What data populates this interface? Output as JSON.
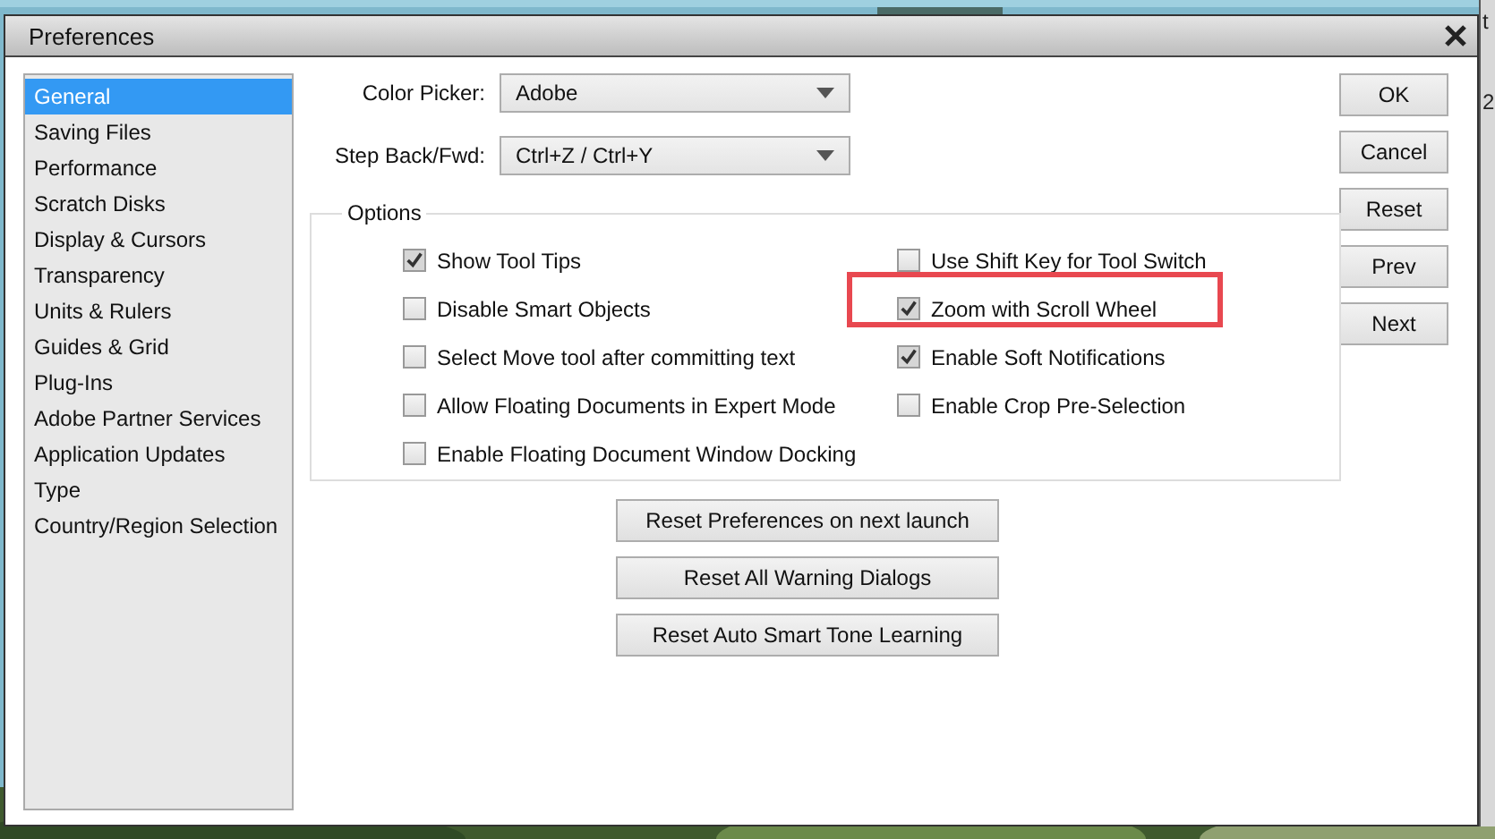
{
  "window": {
    "title": "Preferences"
  },
  "background_window": {
    "texts": [
      "t",
      "2"
    ]
  },
  "sidebar": {
    "items": [
      {
        "label": "General",
        "selected": true
      },
      {
        "label": "Saving Files",
        "selected": false
      },
      {
        "label": "Performance",
        "selected": false
      },
      {
        "label": "Scratch Disks",
        "selected": false
      },
      {
        "label": "Display & Cursors",
        "selected": false
      },
      {
        "label": "Transparency",
        "selected": false
      },
      {
        "label": "Units & Rulers",
        "selected": false
      },
      {
        "label": "Guides & Grid",
        "selected": false
      },
      {
        "label": "Plug-Ins",
        "selected": false
      },
      {
        "label": "Adobe Partner Services",
        "selected": false
      },
      {
        "label": "Application Updates",
        "selected": false
      },
      {
        "label": "Type",
        "selected": false
      },
      {
        "label": "Country/Region Selection",
        "selected": false
      }
    ]
  },
  "fields": [
    {
      "label": "Color Picker:",
      "value": "Adobe"
    },
    {
      "label": "Step Back/Fwd:",
      "value": "Ctrl+Z / Ctrl+Y"
    }
  ],
  "options": {
    "title": "Options",
    "columns": [
      [
        {
          "label": "Show Tool Tips",
          "checked": true,
          "highlighted": false
        },
        {
          "label": "Disable Smart Objects",
          "checked": false,
          "highlighted": false
        },
        {
          "label": "Select Move tool after committing text",
          "checked": false,
          "highlighted": false
        },
        {
          "label": "Allow Floating Documents in Expert Mode",
          "checked": false,
          "highlighted": false
        },
        {
          "label": "Enable Floating Document Window Docking",
          "checked": false,
          "highlighted": false
        }
      ],
      [
        {
          "label": "Use Shift Key for Tool Switch",
          "checked": false,
          "highlighted": false
        },
        {
          "label": "Zoom with Scroll Wheel",
          "checked": true,
          "highlighted": true
        },
        {
          "label": "Enable Soft Notifications",
          "checked": true,
          "highlighted": false
        },
        {
          "label": "Enable Crop Pre-Selection",
          "checked": false,
          "highlighted": false
        }
      ]
    ]
  },
  "reset_buttons": [
    "Reset Preferences on next launch",
    "Reset All Warning Dialogs",
    "Reset Auto Smart Tone Learning"
  ],
  "buttons": [
    "OK",
    "Cancel",
    "Reset",
    "Prev",
    "Next"
  ]
}
